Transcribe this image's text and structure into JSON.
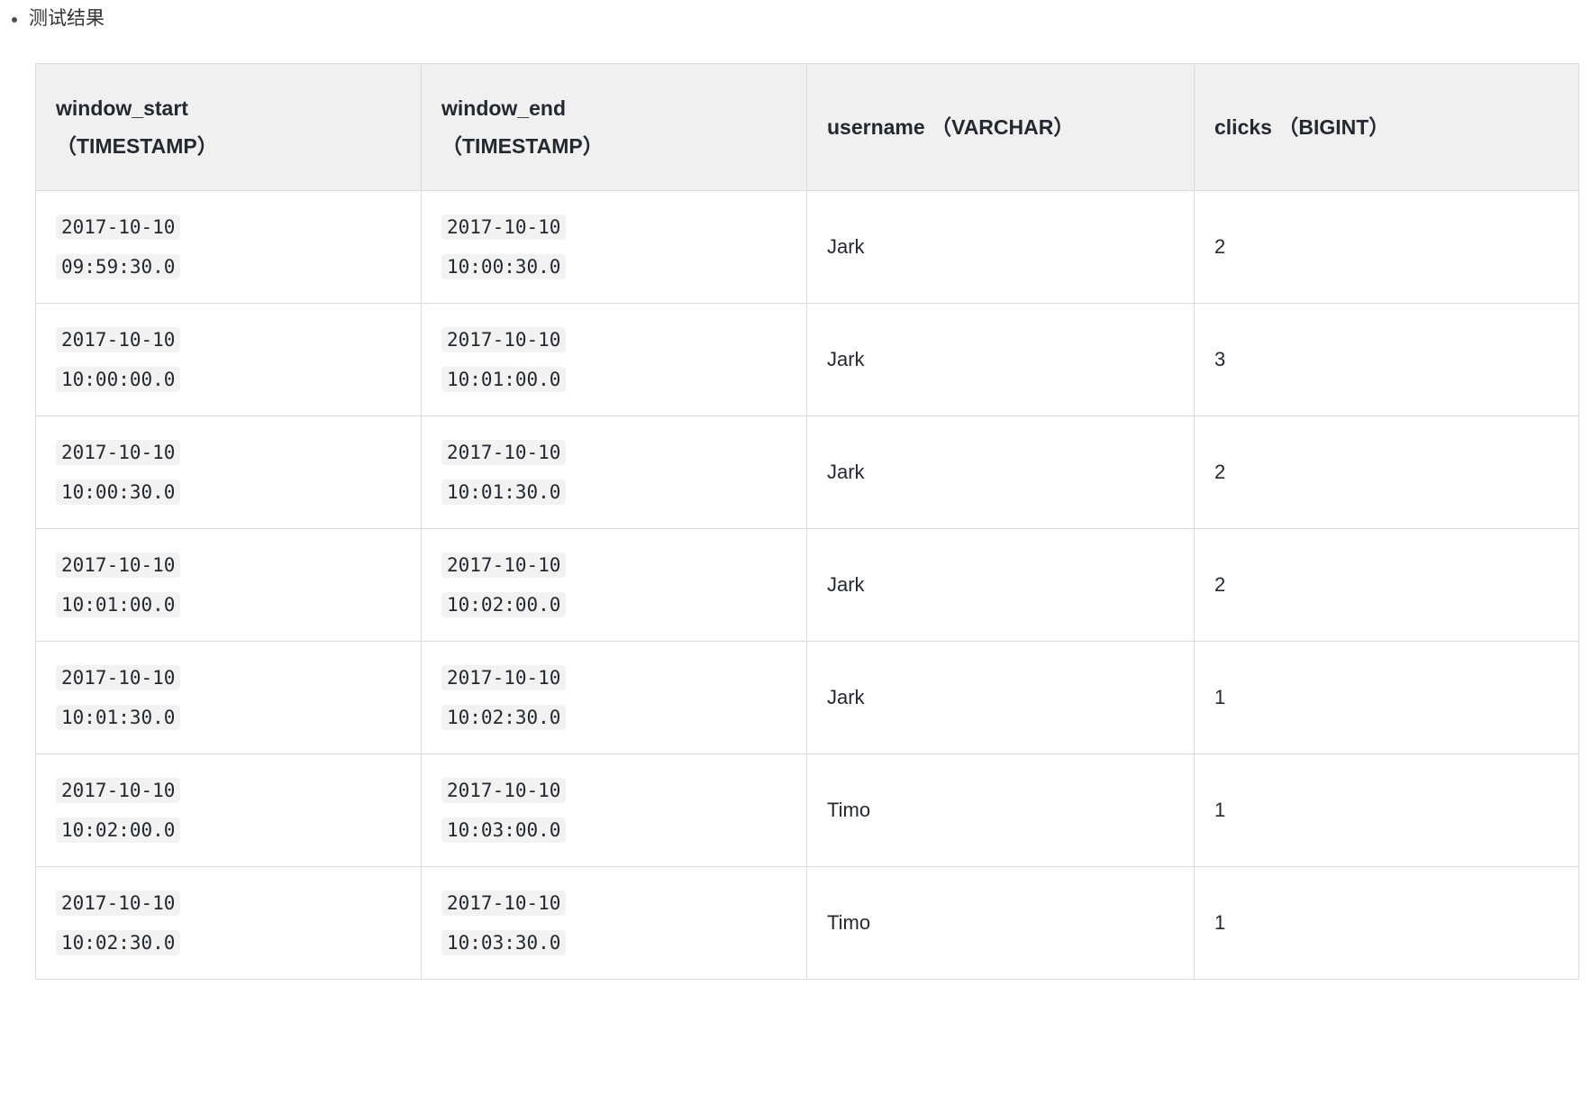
{
  "heading": {
    "bullet_text": "测试结果"
  },
  "table": {
    "columns": [
      {
        "name": "window_start",
        "type": "（TIMESTAMP）"
      },
      {
        "name": "window_end",
        "type": "（TIMESTAMP）"
      },
      {
        "name": "username",
        "type": "（VARCHAR）"
      },
      {
        "name": "clicks",
        "type": "（BIGINT）"
      }
    ],
    "rows": [
      {
        "window_start": "2017-10-10 09:59:30.0",
        "window_end": "2017-10-10 10:00:30.0",
        "username": "Jark",
        "clicks": "2"
      },
      {
        "window_start": "2017-10-10 10:00:00.0",
        "window_end": "2017-10-10 10:01:00.0",
        "username": "Jark",
        "clicks": "3"
      },
      {
        "window_start": "2017-10-10 10:00:30.0",
        "window_end": "2017-10-10 10:01:30.0",
        "username": "Jark",
        "clicks": "2"
      },
      {
        "window_start": "2017-10-10 10:01:00.0",
        "window_end": "2017-10-10 10:02:00.0",
        "username": "Jark",
        "clicks": "2"
      },
      {
        "window_start": "2017-10-10 10:01:30.0",
        "window_end": "2017-10-10 10:02:30.0",
        "username": "Jark",
        "clicks": "1"
      },
      {
        "window_start": "2017-10-10 10:02:00.0",
        "window_end": "2017-10-10 10:03:00.0",
        "username": "Timo",
        "clicks": "1"
      },
      {
        "window_start": "2017-10-10 10:02:30.0",
        "window_end": "2017-10-10 10:03:30.0",
        "username": "Timo",
        "clicks": "1"
      }
    ]
  },
  "colors": {
    "header_bg": "#f0f0f0",
    "border": "#dcdcdc",
    "code_bg": "#f2f2f2",
    "text": "#24292f"
  }
}
